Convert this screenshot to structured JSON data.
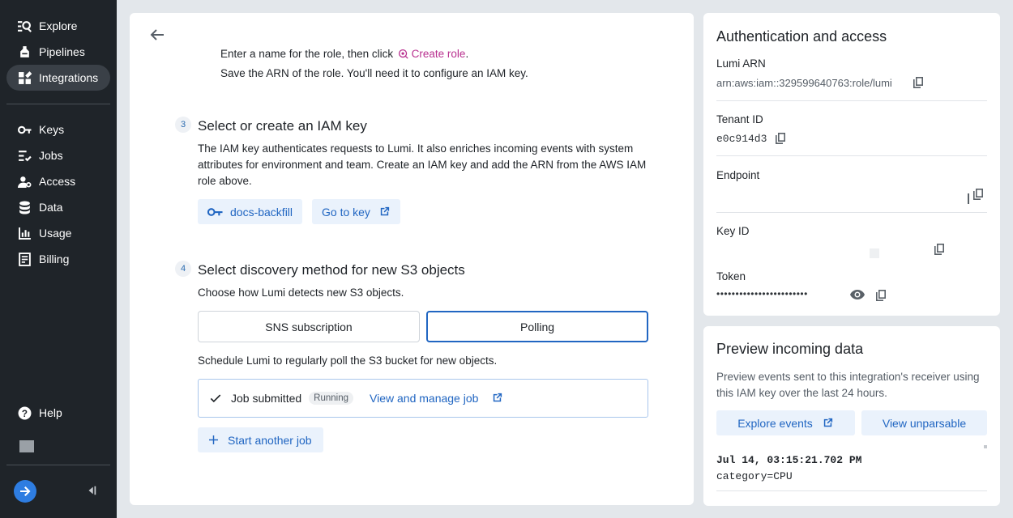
{
  "nav": {
    "explore": "Explore",
    "pipelines": "Pipelines",
    "integrations": "Integrations",
    "keys": "Keys",
    "jobs": "Jobs",
    "access": "Access",
    "data": "Data",
    "usage": "Usage",
    "billing": "Billing",
    "help": "Help"
  },
  "main": {
    "instr_prefix": "Enter a name for the role, then click",
    "create_role": "Create role",
    "instr_period": ".",
    "instr_line2": "Save the ARN of the role. You'll need it to configure an IAM key.",
    "step3": {
      "num": "3",
      "title": "Select or create an IAM key",
      "line1": "The IAM key authenticates requests to Lumi. It also enriches incoming events with system",
      "line2": "attributes for environment and team. Create an IAM key and add the ARN from the AWS IAM",
      "line3": "role above.",
      "key_button": "docs-backfill",
      "go_button": "Go to key"
    },
    "step4": {
      "num": "4",
      "title": "Select discovery method for new S3 objects",
      "desc": "Choose how Lumi detects new S3 objects.",
      "sns": "SNS subscription",
      "polling": "Polling",
      "schedule": "Schedule Lumi to regularly poll the S3 bucket for new objects.",
      "job_submitted": "Job submitted",
      "status": "Running",
      "manage": "View and manage job",
      "start_another": "Start another job"
    }
  },
  "auth": {
    "title": "Authentication and access",
    "arn_label": "Lumi ARN",
    "arn_value": "arn:aws:iam::329599640763:role/lumi",
    "tenant_label": "Tenant ID",
    "tenant_value": "e0c914d3",
    "endpoint_label": "Endpoint",
    "keyid_label": "Key ID",
    "token_label": "Token",
    "token_value": "••••••••••••••••••••••••"
  },
  "preview": {
    "title": "Preview incoming data",
    "desc1": "Preview events sent to this integration's receiver using",
    "desc2": "this IAM key over the last 24 hours.",
    "explore_events": "Explore events",
    "view_unparsable": "View unparsable",
    "event_time": "Jul 14, 03:15:21.702 PM",
    "event_body": "category=CPU"
  },
  "colors": {
    "accent": "#2166c2",
    "create_role": "#b8308f",
    "sidebar": "#1f2429"
  }
}
